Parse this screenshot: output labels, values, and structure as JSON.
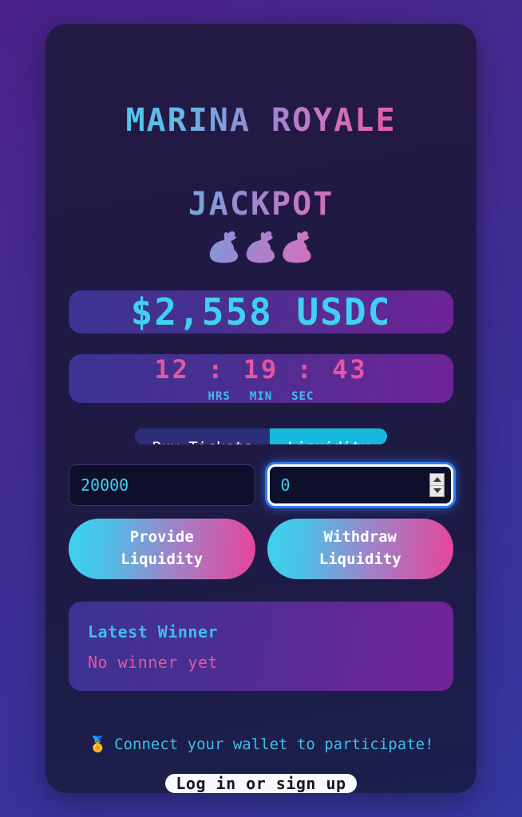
{
  "app": {
    "title_line1": "MARINA ROYALE",
    "title_line2": "JACKPOT",
    "title_bags": "💰💰💰"
  },
  "jackpot": {
    "amount": "$2,558 USDC"
  },
  "timer": {
    "digits": "12 : 19 : 43",
    "label_hours": "HRS",
    "label_minutes": "MIN",
    "label_seconds": "SEC"
  },
  "tabs": [
    {
      "label": "Buy Tickets",
      "active": false
    },
    {
      "label": "Liquidity",
      "active": true
    }
  ],
  "inputs": {
    "amount_value": "20000",
    "amount_placeholder": "",
    "shares_value": "0",
    "shares_placeholder": ""
  },
  "actions": {
    "provide_label": "Provide\nLiquidity",
    "withdraw_label": "Withdraw\nLiquidity"
  },
  "winner": {
    "heading": "Latest Winner",
    "value": "No winner yet"
  },
  "footer": {
    "medal_icon": "🏅",
    "note": "Connect your wallet to participate!",
    "login_label": "Log in or sign up"
  },
  "colors": {
    "accent_cyan": "#3fd2ef",
    "accent_pink": "#e8559f",
    "tab_active": "#17b9dd",
    "card_bg": "#201944"
  }
}
